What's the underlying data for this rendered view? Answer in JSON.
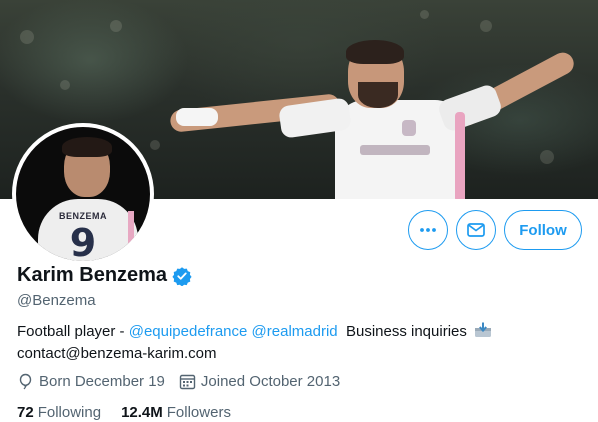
{
  "banner": {
    "description_icon": "banner-photo"
  },
  "avatar": {
    "jersey_name": "BENZEMA",
    "jersey_number": "9"
  },
  "actions": {
    "more_icon": "more-icon",
    "message_icon": "message-icon",
    "follow_label": "Follow"
  },
  "profile": {
    "display_name": "Karim Benzema",
    "verified_icon": "verified-badge-icon",
    "handle": "@Benzema",
    "bio": {
      "prefix": "Football player - ",
      "mention1": "@equipedefrance",
      "mention2": "@realmadrid",
      "business": "  Business inquiries ",
      "email": "contact@benzema-karim.com"
    },
    "born": "Born December 19",
    "joined": "Joined October 2013"
  },
  "stats": {
    "following_count": "72",
    "following_label": "Following",
    "followers_count": "12.4M",
    "followers_label": "Followers"
  },
  "colors": {
    "accent": "#1d9bf0",
    "text": "#0f1419",
    "secondary": "#536471"
  }
}
